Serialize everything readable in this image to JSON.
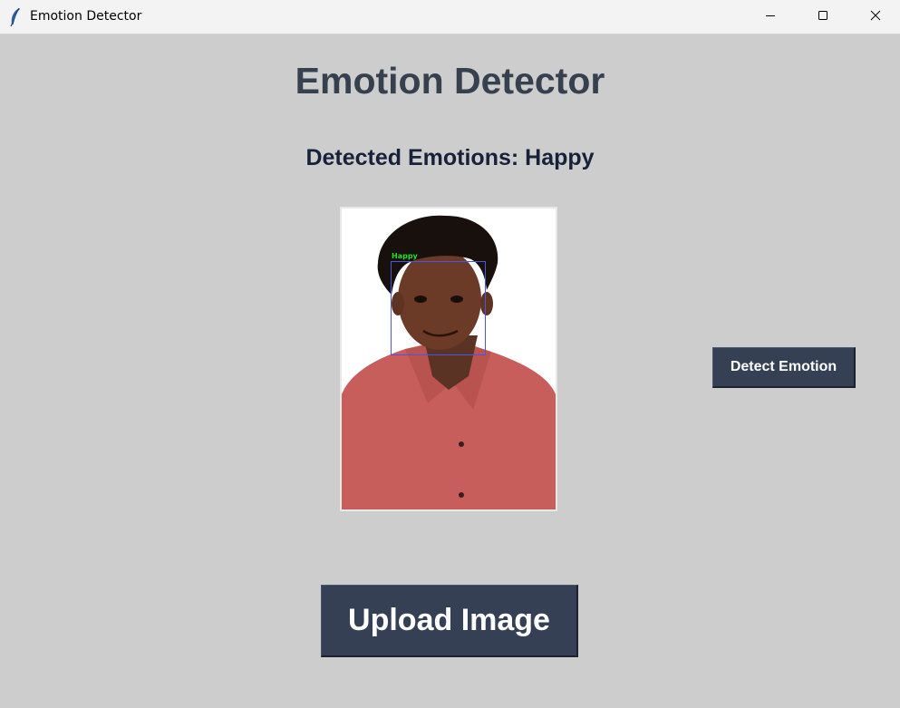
{
  "window": {
    "title": "Emotion Detector",
    "icon": "feather-icon",
    "controls": [
      "minimize-icon",
      "maximize-icon",
      "close-icon"
    ]
  },
  "main": {
    "heading": "Emotion Detector",
    "result_label": "Detected Emotions: Happy",
    "image": {
      "face_label": "Happy",
      "face_box_color": "#4a55e8",
      "face_label_color": "#22e022"
    },
    "detect_button": "Detect Emotion",
    "upload_button": "Upload Image"
  },
  "colors": {
    "background": "#cdcdcd",
    "heading": "#36404f",
    "button": "#364055",
    "button_text": "#ffffff"
  }
}
